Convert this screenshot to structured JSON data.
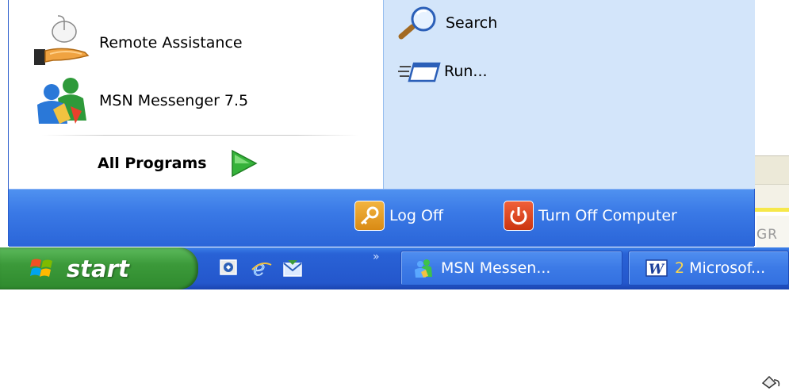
{
  "start_menu": {
    "left_items": [
      {
        "label": "Remote Assistance",
        "icon": "remote-assistance-icon"
      },
      {
        "label": "MSN Messenger 7.5",
        "icon": "msn-messenger-icon"
      }
    ],
    "all_programs": {
      "label": "All Programs",
      "icon": "green-arrow-icon"
    },
    "right_items": [
      {
        "label": "Search",
        "icon": "search-icon"
      },
      {
        "label": "Run...",
        "icon": "run-icon"
      }
    ],
    "footer": {
      "log_off": "Log Off",
      "turn_off": "Turn Off Computer"
    }
  },
  "background_app": {
    "text": "GR"
  },
  "taskbar": {
    "start_label": "start",
    "quick_launch": [
      "desktop-icon",
      "internet-explorer-icon",
      "outlook-express-icon"
    ],
    "overflow": "»",
    "tasks": [
      {
        "label": "MSN Messen...",
        "icon": "msn-messenger-icon"
      },
      {
        "count": "2",
        "label": "Microsof...",
        "icon": "word-icon"
      }
    ]
  },
  "colors": {
    "footer_blue": "#3a79e6",
    "right_pane": "#d3e5fa",
    "start_green": "#3c9a3a",
    "taskbar_blue": "#2457cc"
  }
}
